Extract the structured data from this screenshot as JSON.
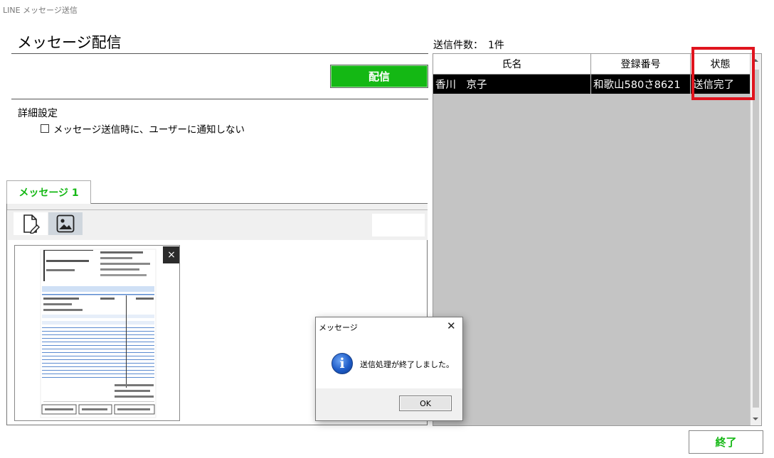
{
  "window": {
    "title": "LINE メッセージ送信"
  },
  "page": {
    "title": "メッセージ配信"
  },
  "actions": {
    "send_label": "配信",
    "end_label": "終了"
  },
  "settings": {
    "title": "詳細設定",
    "no_notify_label": "メッセージ送信時に、ユーザーに通知しない",
    "no_notify_checked": false
  },
  "tabs": [
    {
      "label": "メッセージ 1",
      "active": true
    }
  ],
  "editor": {
    "toolbar": [
      "document-edit-icon",
      "image-icon"
    ],
    "thumbnail_close": "×"
  },
  "recipients": {
    "count_label": "送信件数：　1件",
    "columns": [
      "氏名",
      "登録番号",
      "状態"
    ],
    "rows": [
      {
        "name": "香川　京子",
        "reg_no": "和歌山580さ8621",
        "status": "送信完了"
      }
    ]
  },
  "dialog": {
    "title": "メッセージ",
    "close": "✕",
    "icon": "info-icon",
    "message": "送信処理が終了しました。",
    "ok_label": "OK"
  },
  "colors": {
    "accent_green": "#14b814",
    "highlight_red": "#e0141e",
    "selected_row": "#000000",
    "grid_bg": "#c4c4c4"
  }
}
